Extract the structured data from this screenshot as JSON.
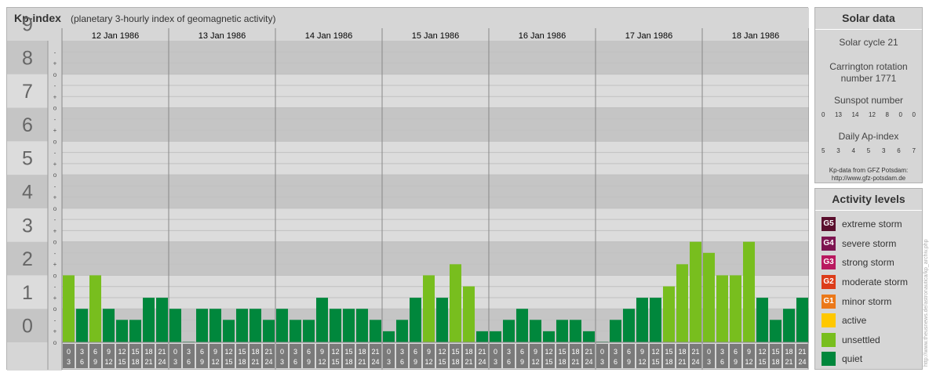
{
  "header": {
    "title": "Kp-index",
    "subtitle": "(planetary 3-hourly index of geomagnetic activity)"
  },
  "colors": {
    "quiet": "#00873c",
    "unsettled": "#78be1e",
    "active": "#ffc800",
    "band_dark": "#c5c5c5",
    "band_light": "#dcdcdc",
    "hour_cell": "#7a7a7a"
  },
  "chart_data": {
    "type": "bar",
    "ylim": [
      0,
      9
    ],
    "y_ticks": [
      "0",
      "1",
      "2",
      "3",
      "4",
      "5",
      "6",
      "7",
      "8",
      "9"
    ],
    "sub_tick_labels": [
      "o",
      "+",
      "-"
    ],
    "days": [
      "12 Jan 1986",
      "13 Jan 1986",
      "14 Jan 1986",
      "15 Jan 1986",
      "16 Jan 1986",
      "17 Jan 1986",
      "18 Jan 1986"
    ],
    "hour_start": [
      "0",
      "3",
      "6",
      "9",
      "12",
      "15",
      "18",
      "21"
    ],
    "hour_end": [
      "3",
      "6",
      "9",
      "12",
      "15",
      "18",
      "21",
      "24"
    ],
    "values": [
      [
        2.0,
        1.0,
        2.0,
        1.0,
        0.67,
        0.67,
        1.33,
        1.33
      ],
      [
        1.0,
        0.0,
        1.0,
        1.0,
        0.67,
        1.0,
        1.0,
        0.67
      ],
      [
        1.0,
        0.67,
        0.67,
        1.33,
        1.0,
        1.0,
        1.0,
        0.67
      ],
      [
        0.33,
        0.67,
        1.33,
        2.0,
        1.33,
        2.33,
        1.67,
        0.33
      ],
      [
        0.33,
        0.67,
        1.0,
        0.67,
        0.33,
        0.67,
        0.67,
        0.33
      ],
      [
        0.0,
        0.67,
        1.0,
        1.33,
        1.33,
        1.67,
        2.33,
        3.0
      ],
      [
        2.67,
        2.0,
        2.0,
        3.0,
        1.33,
        0.67,
        1.0,
        1.33
      ]
    ],
    "series": [
      {
        "name": "quiet",
        "color": "#00873c"
      },
      {
        "name": "unsettled",
        "color": "#78be1e"
      }
    ]
  },
  "solar": {
    "title": "Solar data",
    "cycle": "Solar cycle 21",
    "carrington_line1": "Carrington rotation",
    "carrington_line2": "number 1771",
    "sunspot_label": "Sunspot number",
    "sunspot_values": [
      "0",
      "13",
      "14",
      "12",
      "8",
      "0",
      "0"
    ],
    "ap_label": "Daily Ap-index",
    "ap_values": [
      "5",
      "3",
      "4",
      "5",
      "3",
      "6",
      "7"
    ],
    "credit_line1": "Kp-data from GFZ Potsdam:",
    "credit_line2": "http://www.gfz-potsdam.de"
  },
  "levels": {
    "title": "Activity levels",
    "items": [
      {
        "badge": "G5",
        "label": "extreme storm",
        "color": "#5a0f2d"
      },
      {
        "badge": "G4",
        "label": "severe storm",
        "color": "#7d1450"
      },
      {
        "badge": "G3",
        "label": "strong storm",
        "color": "#b9195f"
      },
      {
        "badge": "G2",
        "label": "moderate storm",
        "color": "#dc3c19"
      },
      {
        "badge": "G1",
        "label": "minor storm",
        "color": "#eb7819"
      },
      {
        "badge": "",
        "label": "active",
        "color": "#ffc800"
      },
      {
        "badge": "",
        "label": "unsettled",
        "color": "#78be1e"
      },
      {
        "badge": "",
        "label": "quiet",
        "color": "#00873c"
      }
    ]
  },
  "watermark": "http://www.theusnews.de/astronautica/kp_archiv.php"
}
